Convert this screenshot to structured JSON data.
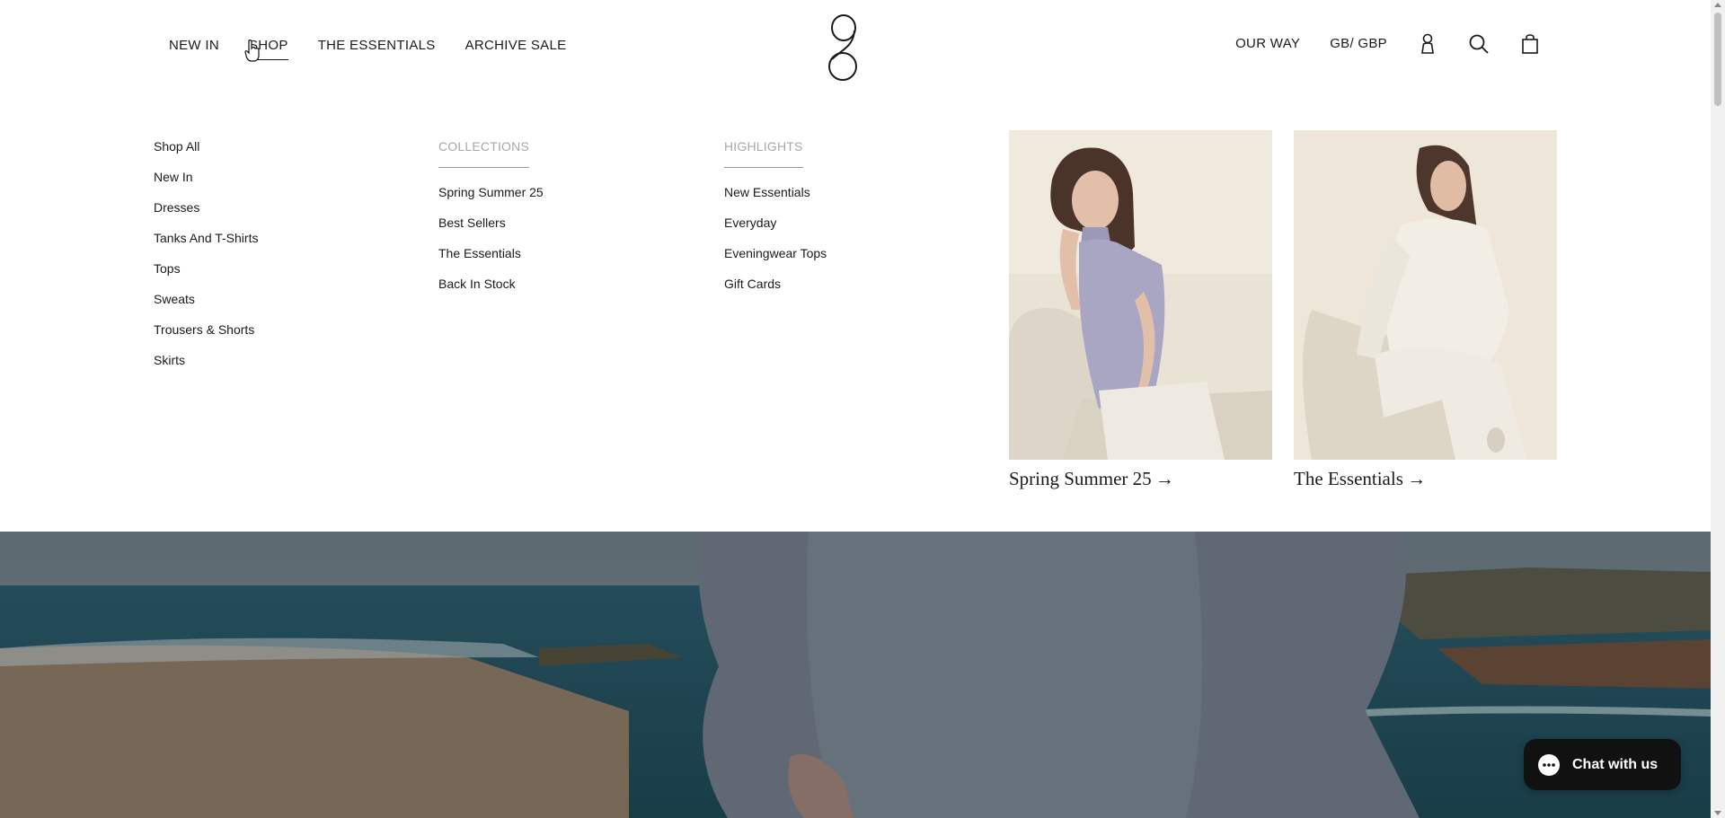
{
  "header": {
    "nav_left": [
      "NEW IN",
      "SHOP",
      "THE ESSENTIALS",
      "ARCHIVE SALE"
    ],
    "active_nav": "SHOP",
    "nav_right": {
      "our_way": "OUR WAY",
      "currency": "GB/ GBP"
    },
    "icons": [
      "account-icon",
      "search-icon",
      "bag-icon"
    ]
  },
  "mega_menu": {
    "shop_links": [
      "Shop All",
      "New In",
      "Dresses",
      "Tanks And T-Shirts",
      "Tops",
      "Sweats",
      "Trousers & Shorts",
      "Skirts"
    ],
    "collections": {
      "heading": "COLLECTIONS",
      "links": [
        "Spring Summer 25",
        "Best Sellers",
        "The Essentials",
        "Back In Stock"
      ]
    },
    "highlights": {
      "heading": "HIGHLIGHTS",
      "links": [
        "New Essentials",
        "Everyday",
        "Eveningwear Tops",
        "Gift Cards"
      ]
    },
    "promos": [
      {
        "caption": "Spring Summer 25 →"
      },
      {
        "caption": "The Essentials →"
      }
    ]
  },
  "chat": {
    "label": "Chat with us"
  },
  "colors": {
    "text": "#1a1a1a",
    "muted_heading": "#a8a8a8",
    "chat_bg": "#111111"
  }
}
